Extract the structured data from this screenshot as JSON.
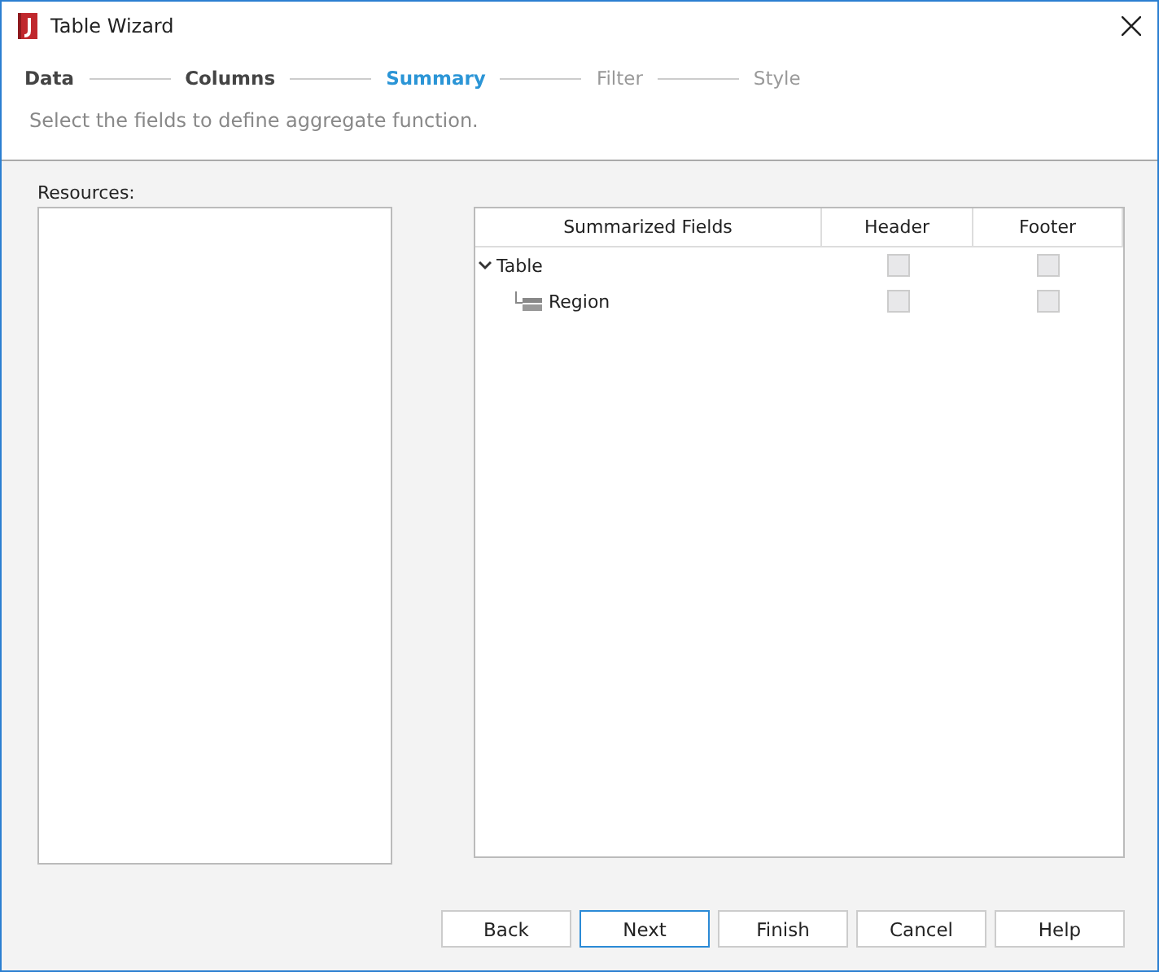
{
  "window": {
    "title": "Table Wizard"
  },
  "steps": [
    {
      "label": "Data",
      "selected": false,
      "completed": true
    },
    {
      "label": "Columns",
      "selected": false,
      "completed": true
    },
    {
      "label": "Summary",
      "selected": true,
      "completed": false
    },
    {
      "label": "Filter",
      "selected": false,
      "completed": false
    },
    {
      "label": "Style",
      "selected": false,
      "completed": false
    }
  ],
  "instruction": "Select the fields to define aggregate function.",
  "resources": {
    "label": "Resources:"
  },
  "table": {
    "columns": [
      "Summarized Fields",
      "Header",
      "Footer"
    ],
    "rows": [
      {
        "label": "Table",
        "expanded": true,
        "header": {
          "checked": false,
          "disabled": true
        },
        "footer": {
          "checked": false,
          "disabled": true
        },
        "children": [
          {
            "label": "Region",
            "header": {
              "checked": false,
              "disabled": true
            },
            "footer": {
              "checked": false,
              "disabled": true
            }
          }
        ]
      }
    ]
  },
  "buttons": [
    {
      "label": "Back",
      "focused": false
    },
    {
      "label": "Next",
      "focused": true
    },
    {
      "label": "Finish",
      "focused": false
    },
    {
      "label": "Cancel",
      "focused": false
    },
    {
      "label": "Help",
      "focused": false
    }
  ]
}
